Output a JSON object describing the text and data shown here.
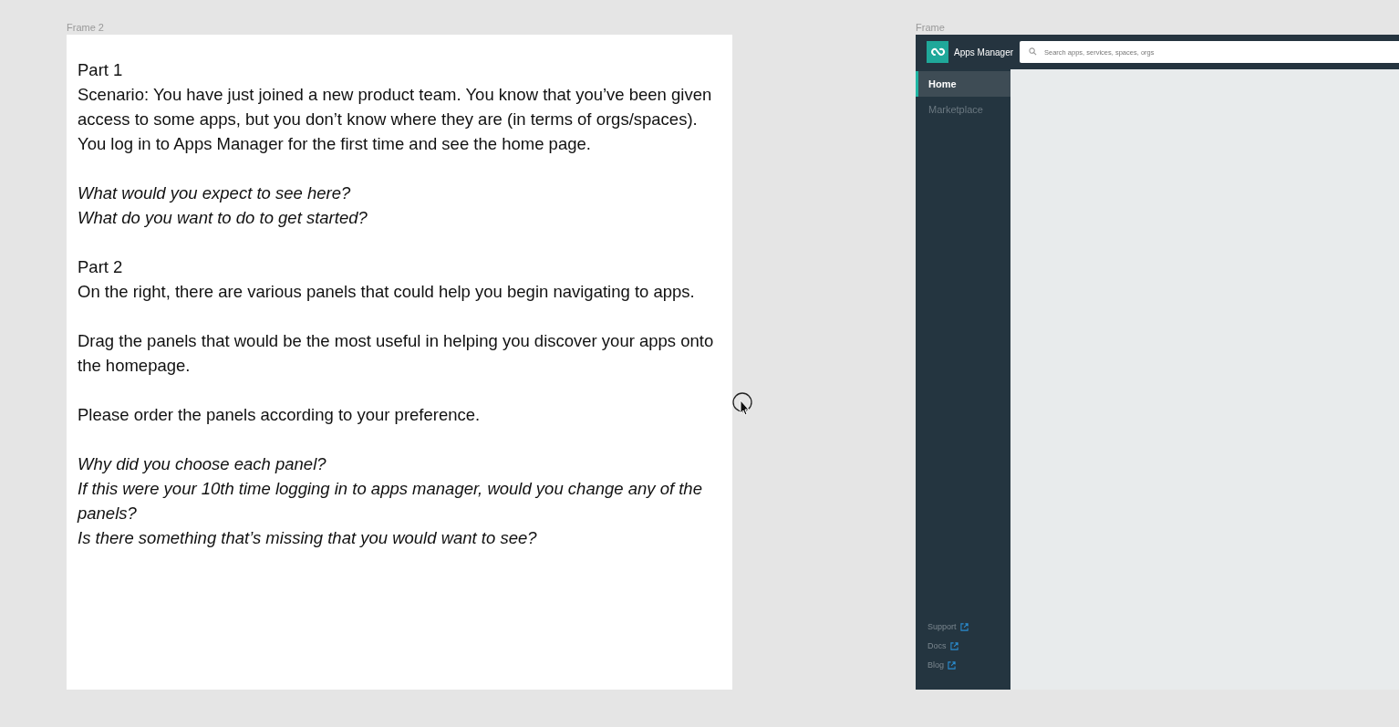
{
  "frames": [
    {
      "label": "Frame 2"
    },
    {
      "label": "Frame"
    }
  ],
  "task_blocks": [
    {
      "italic": false,
      "lines": [
        "Part 1",
        "Scenario: You have just joined a new product team. You know that you’ve been given access to some apps, but you don’t know where they are (in terms of orgs/spaces). You log in to Apps Manager for the first time and see the home page."
      ]
    },
    {
      "italic": true,
      "lines": [
        "What would you expect to see here?",
        "What do you want to do to get started?"
      ]
    },
    {
      "italic": false,
      "lines": [
        "Part 2",
        "On the right, there are various panels that could help you begin navigating to apps."
      ]
    },
    {
      "italic": false,
      "lines": [
        "Drag the panels that would be the most useful in helping you discover your apps onto the homepage."
      ]
    },
    {
      "italic": false,
      "lines": [
        "Please order the panels according to your preference."
      ]
    },
    {
      "italic": true,
      "lines": [
        "Why did you choose each panel?",
        "If this were your 10th time logging in to apps manager, would you change any of the panels?",
        "Is there something that’s missing that you would want to see?"
      ]
    }
  ],
  "app": {
    "title": "Apps Manager",
    "search": {
      "placeholder": "Search apps, services, spaces, orgs"
    },
    "nav": [
      {
        "label": "Home",
        "selected": true
      },
      {
        "label": "Marketplace",
        "selected": false
      }
    ],
    "footer_links": [
      "Support",
      "Docs",
      "Blog"
    ]
  }
}
